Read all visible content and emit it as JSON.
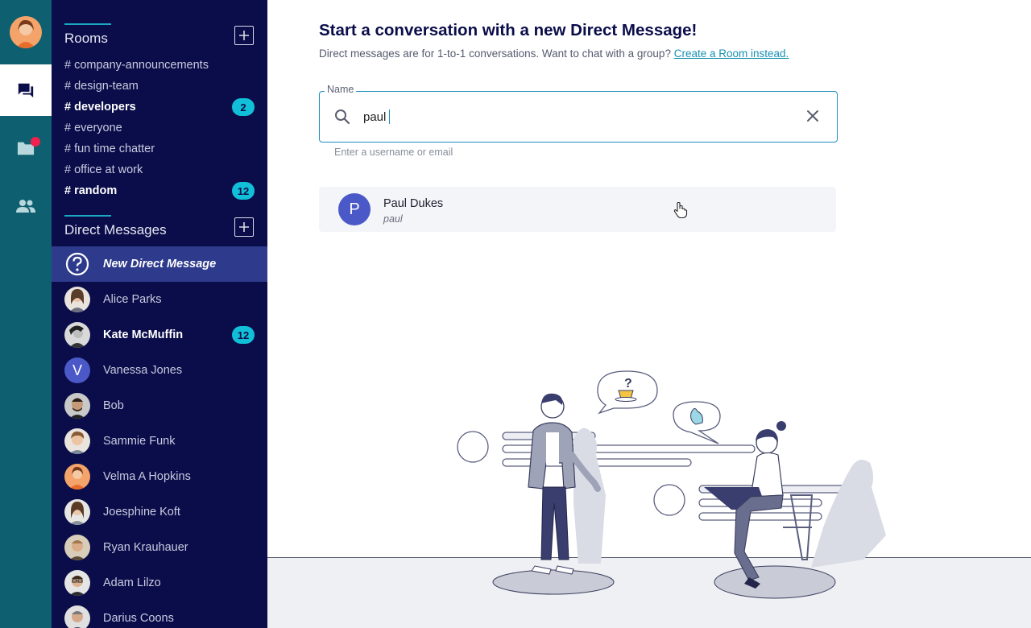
{
  "rail": {
    "items": [
      {
        "name": "chat",
        "active": true
      },
      {
        "name": "files",
        "active": false,
        "notification": true
      },
      {
        "name": "people",
        "active": false
      }
    ]
  },
  "sidebar": {
    "rooms_title": "Rooms",
    "rooms": [
      {
        "label": "# company-announcements",
        "bold": false,
        "badge": ""
      },
      {
        "label": "# design-team",
        "bold": false,
        "badge": ""
      },
      {
        "label": "# developers",
        "bold": true,
        "badge": "2"
      },
      {
        "label": "# everyone",
        "bold": false,
        "badge": ""
      },
      {
        "label": "# fun time chatter",
        "bold": false,
        "badge": ""
      },
      {
        "label": "# office at work",
        "bold": false,
        "badge": ""
      },
      {
        "label": "# random",
        "bold": true,
        "badge": "12"
      }
    ],
    "dm_title": "Direct Messages",
    "dms": [
      {
        "label": "New Direct Message",
        "selected": true,
        "avatar": "help-icon",
        "badge": ""
      },
      {
        "label": "Alice Parks",
        "avatar": "photo",
        "badge": ""
      },
      {
        "label": "Kate McMuffin",
        "bold": true,
        "avatar": "photo",
        "badge": "12"
      },
      {
        "label": "Vanessa Jones",
        "avatar": "V",
        "badge": ""
      },
      {
        "label": "Bob",
        "avatar": "photo",
        "badge": ""
      },
      {
        "label": "Sammie Funk",
        "avatar": "photo",
        "badge": ""
      },
      {
        "label": "Velma A Hopkins",
        "avatar": "photo",
        "badge": ""
      },
      {
        "label": "Joesphine Koft",
        "avatar": "photo",
        "badge": ""
      },
      {
        "label": "Ryan Krauhauer",
        "avatar": "photo",
        "badge": ""
      },
      {
        "label": "Adam Lilzo",
        "avatar": "photo",
        "badge": ""
      },
      {
        "label": "Darius Coons",
        "avatar": "photo",
        "badge": ""
      }
    ]
  },
  "main": {
    "title": "Start a conversation with a new Direct Message!",
    "subtitle": "Direct messages are for 1-to-1 conversations. Want to chat with a group?",
    "subtitle_link": "Create a Room instead.",
    "field_label": "Name",
    "field_value": "paul",
    "helper": "Enter a username or email",
    "result": {
      "initial": "P",
      "name": "Paul Dukes",
      "username": "paul"
    }
  },
  "colors": {
    "rail": "#0e5f6f",
    "sidebar": "#0b0d4a",
    "selected": "#2e3a8c",
    "badge": "#12bfd8",
    "accent": "#1f8fc0",
    "avatar_blue": "#4b59c8"
  }
}
